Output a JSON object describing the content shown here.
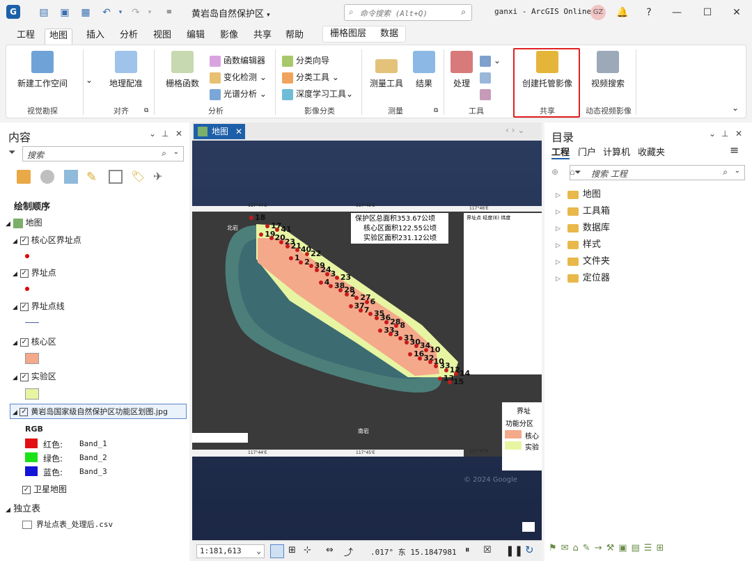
{
  "title_bar": {
    "project_title": "黄岩岛自然保护区",
    "command_search_placeholder": "命令搜索 (Alt+Q)",
    "user": "ganxi - ArcGIS Online",
    "avatar_initials": "GZ"
  },
  "ribbon_tabs": [
    "工程",
    "地图",
    "插入",
    "分析",
    "视图",
    "编辑",
    "影像",
    "共享",
    "帮助"
  ],
  "ribbon_active_tab": "地图",
  "contextual_tabs": [
    "栅格图层",
    "数据"
  ],
  "ribbon": {
    "new_workspace": "新建工作空间",
    "georef": "地理配准",
    "raster_function": "栅格函数",
    "function_editor": "函数编辑器",
    "change_detection": "变化检测",
    "spectral_analysis": "光谱分析",
    "classify_wizard": "分类向导",
    "classify_tools": "分类工具",
    "deep_learning": "深度学习工具",
    "measure_tools": "测量工具",
    "results": "结果",
    "process": "处理",
    "create_hosted_imagery": "创建托管影像",
    "video_search": "视频搜索",
    "groups": {
      "visual_exploration": "视觉勘探",
      "align": "对齐",
      "analysis": "分析",
      "image_classification": "影像分类",
      "measure": "测量",
      "tools": "工具",
      "share": "共享",
      "motion_video": "动态视频影像"
    }
  },
  "contents": {
    "title": "内容",
    "search_placeholder": "搜索",
    "drawing_order": "绘制顺序",
    "map_name": "地图",
    "layers": [
      {
        "name": "核心区界址点",
        "checked": true
      },
      {
        "name": "界址点",
        "checked": true
      },
      {
        "name": "界址点线",
        "checked": true
      },
      {
        "name": "核心区",
        "checked": true,
        "color": "#f4a98b"
      },
      {
        "name": "实验区",
        "checked": true,
        "color": "#e7f5a3"
      },
      {
        "name": "黄岩岛国家级自然保护区功能区划图.jpg",
        "checked": true
      }
    ],
    "rgb_label": "RGB",
    "bands": [
      {
        "label": "红色:",
        "band": "Band_1",
        "color": "#e21010"
      },
      {
        "label": "绿色:",
        "band": "Band_2",
        "color": "#19e219"
      },
      {
        "label": "蓝色:",
        "band": "Band_3",
        "color": "#1414d6"
      }
    ],
    "basemap": "卫星地图",
    "standalone_tables_header": "独立表",
    "table": "界址点表_处理后.csv"
  },
  "map_view": {
    "tab_label": "地图",
    "scale": "1:181,613",
    "coordinates": ".017° 东 15.1847981",
    "watermark": "© 2024 Google",
    "image_stats": [
      "保护区总面积353.67公顷",
      "核心区面积122.55公顷",
      "实验区面积231.12公顷"
    ],
    "graticule_top": [
      "117°44'E",
      "117°45'E",
      "117°46'E"
    ],
    "graticule_bottom": [
      "117°44'E",
      "117°45'E",
      "117°47'E"
    ],
    "legend_items": [
      "界址",
      "功能分区",
      "核心",
      "实验"
    ],
    "place_labels": [
      "南岩",
      "北岩"
    ],
    "table_header": [
      "界址点",
      "经度(E)",
      "纬度"
    ],
    "point_labels": [
      "18",
      "17",
      "19",
      "41",
      "20",
      "21",
      "23",
      "40",
      "1",
      "22",
      "2",
      "24",
      "39",
      "3",
      "4",
      "23",
      "38",
      "2",
      "28",
      "27",
      "37",
      "6",
      "7",
      "36",
      "35",
      "28",
      "33",
      "8",
      "3",
      "30",
      "31",
      "34",
      "16",
      "10",
      "32",
      "33",
      "10",
      "12",
      "13",
      "14",
      "15"
    ]
  },
  "catalog": {
    "title": "目录",
    "tabs": [
      "工程",
      "门户",
      "计算机",
      "收藏夹"
    ],
    "search_placeholder": "搜索 工程",
    "items": [
      "地图",
      "工具箱",
      "数据库",
      "样式",
      "文件夹",
      "定位器"
    ]
  }
}
